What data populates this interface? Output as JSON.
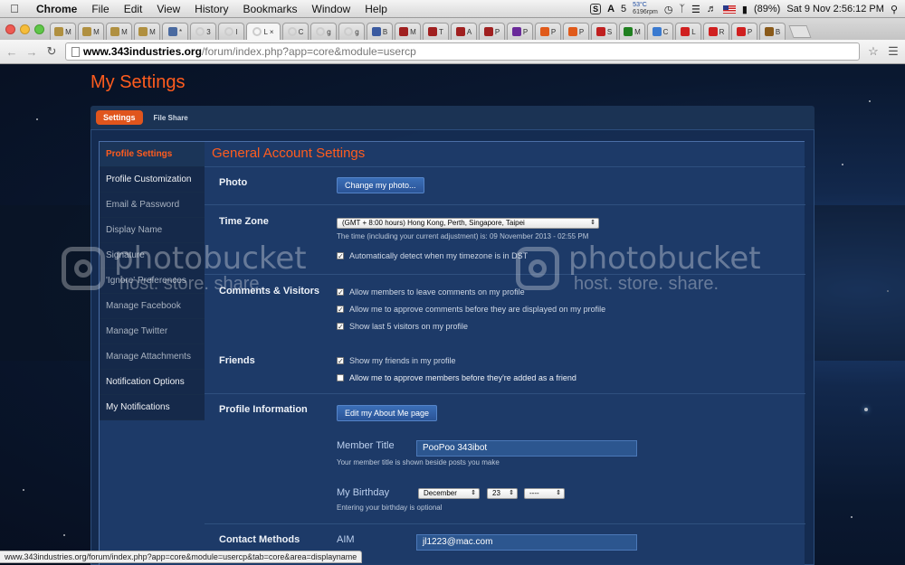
{
  "menubar": {
    "app_name": "Chrome",
    "menus": [
      "File",
      "Edit",
      "View",
      "History",
      "Bookmarks",
      "Window",
      "Help"
    ],
    "status_label": "5",
    "temperature": "53°C",
    "fan_speed": "6196rpm",
    "battery": "(89%)",
    "datetime": "Sat 9 Nov  2:56:12 PM"
  },
  "tabs": [
    {
      "label": "M",
      "icon": "halo-icon",
      "color": "#b09040"
    },
    {
      "label": "M",
      "icon": "halo-icon",
      "color": "#b09040"
    },
    {
      "label": "M",
      "icon": "halo-icon",
      "color": "#b09040"
    },
    {
      "label": "M",
      "icon": "halo-icon",
      "color": "#b09040"
    },
    {
      "label": "*",
      "icon": "globe-icon",
      "color": "#4a6aa0"
    },
    {
      "label": "3",
      "icon": "loading-icon",
      "color": "#cccccc"
    },
    {
      "label": "I",
      "icon": "loading-icon",
      "color": "#cccccc"
    },
    {
      "label": "L",
      "icon": "loading-icon",
      "color": "#cccccc",
      "active": true
    },
    {
      "label": "C",
      "icon": "loading-icon",
      "color": "#cccccc"
    },
    {
      "label": "g",
      "icon": "loading-icon",
      "color": "#cccccc"
    },
    {
      "label": "g",
      "icon": "loading-icon",
      "color": "#cccccc"
    },
    {
      "label": "B",
      "icon": "b-icon",
      "color": "#3a5aa0"
    },
    {
      "label": "M",
      "icon": "avatar-icon",
      "color": "#a02020"
    },
    {
      "label": "T",
      "icon": "avatar-icon",
      "color": "#a02020"
    },
    {
      "label": "A",
      "icon": "avatar-icon",
      "color": "#a02020"
    },
    {
      "label": "P",
      "icon": "avatar-icon",
      "color": "#a02020"
    },
    {
      "label": "P",
      "icon": "yahoo-icon",
      "color": "#6a2a9a"
    },
    {
      "label": "P",
      "icon": "star-icon",
      "color": "#e05a1a"
    },
    {
      "label": "P",
      "icon": "star-icon",
      "color": "#e05a1a"
    },
    {
      "label": "S",
      "icon": "s-icon",
      "color": "#c02020"
    },
    {
      "label": "M",
      "icon": "matrix-icon",
      "color": "#208020"
    },
    {
      "label": "C",
      "icon": "c-icon",
      "color": "#3a7ad0"
    },
    {
      "label": "L",
      "icon": "youtube-icon",
      "color": "#d02020"
    },
    {
      "label": "R",
      "icon": "youtube-icon",
      "color": "#d02020"
    },
    {
      "label": "P",
      "icon": "youtube-icon",
      "color": "#d02020"
    },
    {
      "label": "B",
      "icon": "film-icon",
      "color": "#8a5a1a"
    }
  ],
  "address": {
    "domain": "www.343industries.org",
    "path": "/forum/index.php?app=core&module=usercp"
  },
  "page": {
    "title": "My Settings",
    "tab_settings": "Settings",
    "tab_file_share": "File Share",
    "section_title": "General Account Settings"
  },
  "sidebar": {
    "items": [
      "Profile Settings",
      "Profile Customization",
      "Email & Password",
      "Display Name",
      "Signature",
      "'Ignore' Preferences",
      "Manage Facebook",
      "Manage Twitter",
      "Manage Attachments",
      "Notification Options",
      "My Notifications"
    ]
  },
  "photo": {
    "label": "Photo",
    "button": "Change my photo..."
  },
  "timezone": {
    "label": "Time Zone",
    "selected": "(GMT + 8:00 hours) Hong Kong, Perth, Singapore, Taipei",
    "current_time": "The time (including your current adjustment) is: 09 November 2013 - 02:55 PM",
    "auto_detect": "Automatically detect when my timezone is in DST"
  },
  "comments": {
    "label": "Comments & Visitors",
    "options": [
      {
        "text": "Allow members to leave comments on my profile",
        "checked": true
      },
      {
        "text": "Allow me to approve comments before they are displayed on my profile",
        "checked": true
      },
      {
        "text": "Show last 5 visitors on my profile",
        "checked": true
      }
    ]
  },
  "friends": {
    "label": "Friends",
    "options": [
      {
        "text": "Show my friends in my profile",
        "checked": true
      },
      {
        "text": "Allow me to approve members before they're added as a friend",
        "checked": false
      }
    ]
  },
  "profile_info": {
    "label": "Profile Information",
    "button": "Edit my About Me page",
    "member_title_label": "Member Title",
    "member_title_value": "PooPoo 343ibot",
    "member_title_note": "Your member title is shown beside posts you make",
    "birthday_label": "My Birthday",
    "birthday_month": "December",
    "birthday_day": "23",
    "birthday_year": "----",
    "birthday_note": "Entering your birthday is optional"
  },
  "contact": {
    "label": "Contact Methods",
    "aim_label": "AIM",
    "aim_value": "jl1223@mac.com"
  },
  "status_url": "www.343industries.org/forum/index.php?app=core&module=usercp&tab=core&area=displayname",
  "watermark": {
    "brand": "photobucket",
    "tagline": "host. store. share."
  }
}
